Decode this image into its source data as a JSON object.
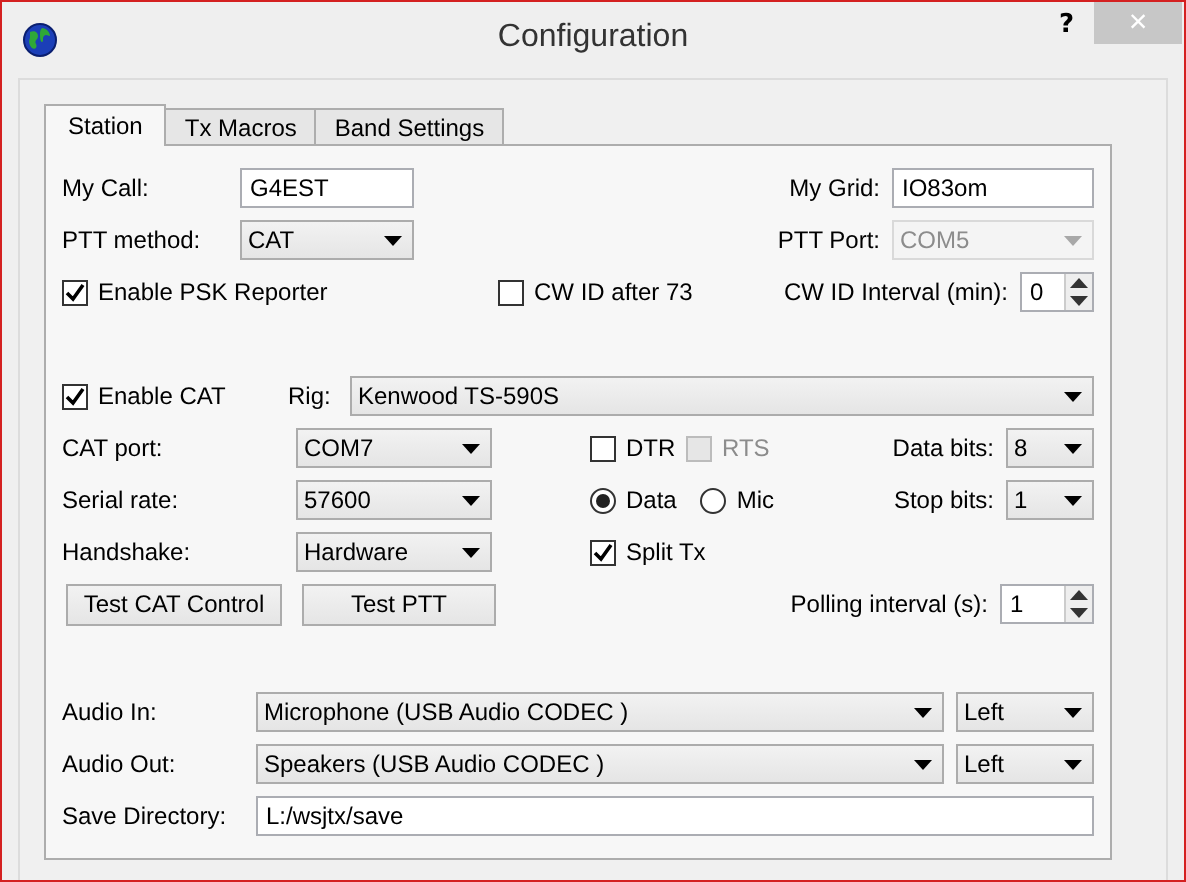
{
  "window": {
    "title": "Configuration",
    "help": "?",
    "close": "×"
  },
  "tabs": [
    {
      "label": "Station",
      "selected": true
    },
    {
      "label": "Tx Macros",
      "selected": false
    },
    {
      "label": "Band Settings",
      "selected": false
    }
  ],
  "my_call": {
    "label": "My Call:",
    "value": "G4EST"
  },
  "my_grid": {
    "label": "My Grid:",
    "value": "IO83om"
  },
  "ptt_method": {
    "label": "PTT method:",
    "value": "CAT",
    "disabled": false
  },
  "ptt_port": {
    "label": "PTT Port:",
    "value": "COM5",
    "disabled": true
  },
  "enable_psk_reporter": {
    "label": "Enable PSK Reporter",
    "checked": true,
    "disabled": false
  },
  "cw_id_after_73": {
    "label": "CW ID after 73",
    "checked": false,
    "disabled": false
  },
  "cw_id_interval": {
    "label": "CW ID Interval (min):",
    "value": "0"
  },
  "enable_cat": {
    "label": "Enable CAT",
    "checked": true,
    "disabled": false
  },
  "rig": {
    "label": "Rig:",
    "value": "Kenwood TS-590S",
    "disabled": false
  },
  "cat_port": {
    "label": "CAT port:",
    "value": "COM7",
    "disabled": false
  },
  "serial_rate": {
    "label": "Serial rate:",
    "value": "57600",
    "disabled": false
  },
  "handshake": {
    "label": "Handshake:",
    "value": "Hardware",
    "disabled": false
  },
  "dtr": {
    "label": "DTR",
    "checked": false,
    "disabled": false
  },
  "rts": {
    "label": "RTS",
    "checked": false,
    "disabled": true
  },
  "mode_radios": [
    {
      "label": "Data",
      "selected": true
    },
    {
      "label": "Mic",
      "selected": false
    }
  ],
  "split_tx": {
    "label": "Split Tx",
    "checked": true,
    "disabled": false
  },
  "data_bits": {
    "label": "Data bits:",
    "value": "8",
    "disabled": false
  },
  "stop_bits": {
    "label": "Stop bits:",
    "value": "1",
    "disabled": false
  },
  "buttons": [
    "Test CAT Control",
    "Test PTT"
  ],
  "polling_interval": {
    "label": "Polling interval (s):",
    "value": "1"
  },
  "audio_in": {
    "label": "Audio In:",
    "device": "Microphone (USB Audio CODEC )",
    "channel": "Left"
  },
  "audio_out": {
    "label": "Audio Out:",
    "device": "Speakers (USB Audio CODEC )",
    "channel": "Left"
  },
  "save_directory": {
    "label": "Save Directory:",
    "value": "L:/wsjtx/save"
  }
}
